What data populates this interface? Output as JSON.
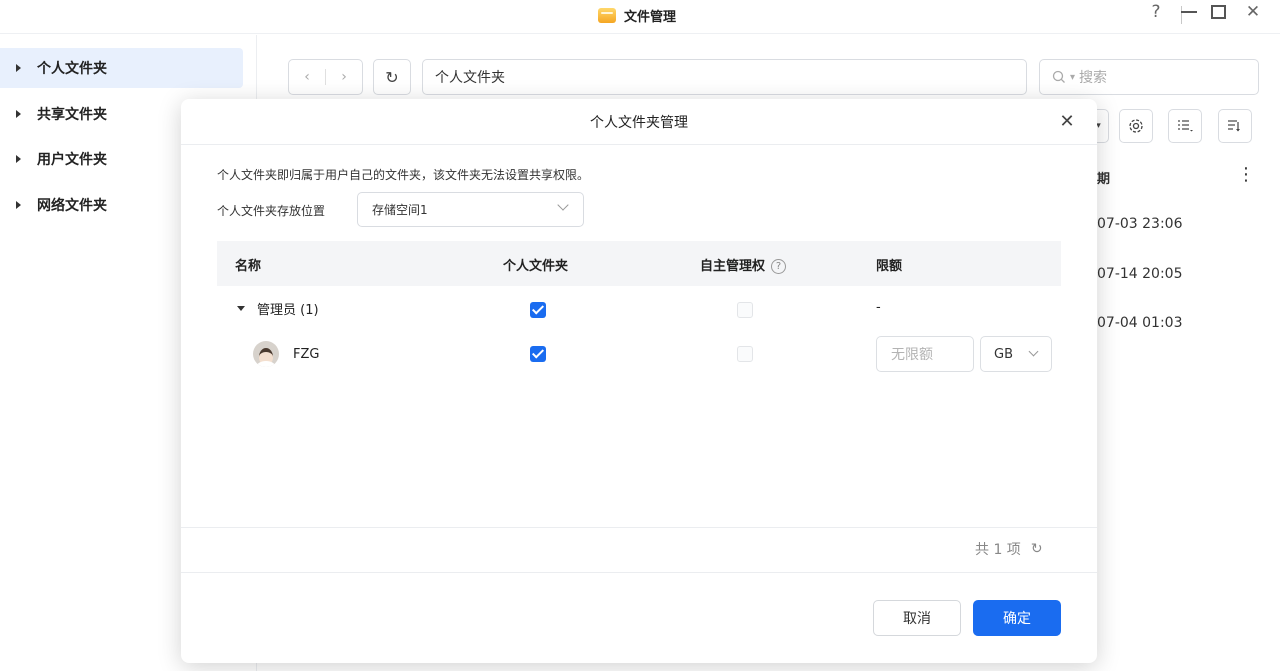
{
  "window": {
    "title": "文件管理",
    "app_icon": "folder-icon",
    "controls": {
      "help": "?",
      "close": "✕"
    }
  },
  "sidebar": {
    "items": [
      {
        "label": "个人文件夹",
        "active": true
      },
      {
        "label": "共享文件夹",
        "active": false
      },
      {
        "label": "用户文件夹",
        "active": false
      },
      {
        "label": "网络文件夹",
        "active": false
      }
    ]
  },
  "toolbar": {
    "back": "‹",
    "forward": "›",
    "refresh": "↻",
    "path": "个人文件夹",
    "search_placeholder": "搜索",
    "search_icon": "search-icon"
  },
  "background_list": {
    "column_header": "期",
    "more": "⋮",
    "dates": [
      "07-03 23:06",
      "07-14 20:05",
      "07-04 01:03"
    ]
  },
  "dialog": {
    "title": "个人文件夹管理",
    "close": "✕",
    "description": "个人文件夹即归属于用户自己的文件夹，该文件夹无法设置共享权限。",
    "location_label": "个人文件夹存放位置",
    "location_value": "存储空间1",
    "table": {
      "headers": {
        "name": "名称",
        "personal": "个人文件夹",
        "self_manage": "自主管理权",
        "help": "?",
        "quota": "限额"
      },
      "group": {
        "name": "管理员 (1)",
        "personal_checked": true,
        "self_manage_checked": false,
        "quota": "-"
      },
      "user": {
        "name": "FZG",
        "personal_checked": true,
        "self_manage_checked": false,
        "quota_placeholder": "无限额",
        "unit": "GB"
      }
    },
    "count_text": "共 1 项",
    "count_refresh": "↻",
    "cancel_label": "取消",
    "ok_label": "确定",
    "colors": {
      "accent": "#1a6cf0"
    }
  }
}
